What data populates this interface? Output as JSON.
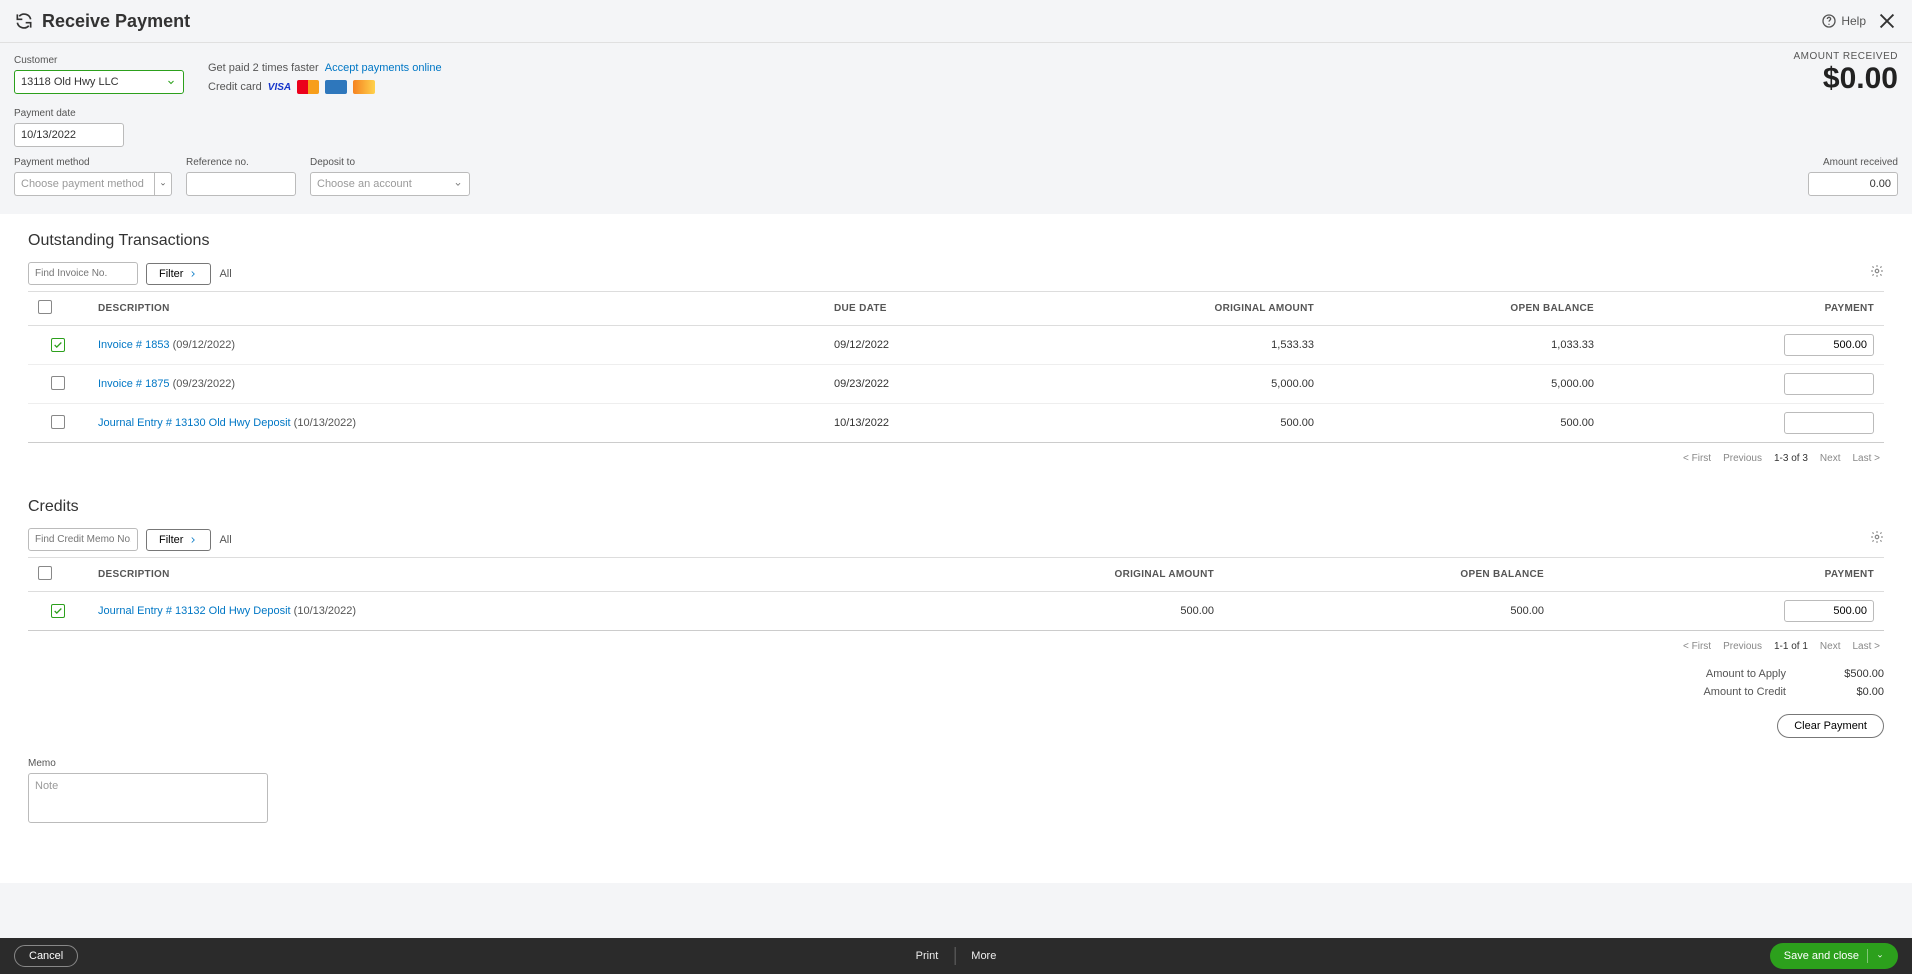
{
  "header": {
    "title": "Receive Payment",
    "help_label": "Help"
  },
  "customer": {
    "label": "Customer",
    "value": "13118 Old Hwy LLC"
  },
  "promo": {
    "prefix": "Get paid 2 times faster",
    "link": "Accept payments online",
    "cc_label": "Credit card"
  },
  "amount_display": {
    "label": "AMOUNT RECEIVED",
    "value": "$0.00"
  },
  "fields": {
    "payment_date": {
      "label": "Payment date",
      "value": "10/13/2022"
    },
    "payment_method": {
      "label": "Payment method",
      "placeholder": "Choose payment method"
    },
    "reference_no": {
      "label": "Reference no.",
      "value": ""
    },
    "deposit_to": {
      "label": "Deposit to",
      "placeholder": "Choose an account"
    },
    "amount_received": {
      "label": "Amount received",
      "value": "0.00"
    }
  },
  "outstanding": {
    "title": "Outstanding Transactions",
    "search_placeholder": "Find Invoice No.",
    "filter_label": "Filter",
    "all_label": "All",
    "columns": {
      "description": "DESCRIPTION",
      "due_date": "DUE DATE",
      "original_amount": "ORIGINAL AMOUNT",
      "open_balance": "OPEN BALANCE",
      "payment": "PAYMENT"
    },
    "rows": [
      {
        "checked": true,
        "link_text": "Invoice # 1853",
        "suffix": " (09/12/2022)",
        "due_date": "09/12/2022",
        "original": "1,533.33",
        "open": "1,033.33",
        "payment": "500.00"
      },
      {
        "checked": false,
        "link_text": "Invoice # 1875",
        "suffix": " (09/23/2022)",
        "due_date": "09/23/2022",
        "original": "5,000.00",
        "open": "5,000.00",
        "payment": ""
      },
      {
        "checked": false,
        "link_text": "Journal Entry # 13130 Old Hwy Deposit",
        "suffix": " (10/13/2022)",
        "due_date": "10/13/2022",
        "original": "500.00",
        "open": "500.00",
        "payment": ""
      }
    ],
    "pager": {
      "first": "< First",
      "prev": "Previous",
      "range": "1-3 of 3",
      "next": "Next",
      "last": "Last >"
    }
  },
  "credits": {
    "title": "Credits",
    "search_placeholder": "Find Credit Memo No.",
    "filter_label": "Filter",
    "all_label": "All",
    "columns": {
      "description": "DESCRIPTION",
      "original_amount": "ORIGINAL AMOUNT",
      "open_balance": "OPEN BALANCE",
      "payment": "PAYMENT"
    },
    "rows": [
      {
        "checked": true,
        "link_text": "Journal Entry # 13132 Old Hwy Deposit",
        "suffix": " (10/13/2022)",
        "original": "500.00",
        "open": "500.00",
        "payment": "500.00"
      }
    ],
    "pager": {
      "first": "< First",
      "prev": "Previous",
      "range": "1-1 of 1",
      "next": "Next",
      "last": "Last >"
    }
  },
  "totals": {
    "apply_label": "Amount to Apply",
    "apply_value": "$500.00",
    "credit_label": "Amount to Credit",
    "credit_value": "$0.00",
    "clear_label": "Clear Payment"
  },
  "memo": {
    "label": "Memo",
    "placeholder": "Note"
  },
  "footer": {
    "cancel": "Cancel",
    "print": "Print",
    "more": "More",
    "save": "Save and close"
  }
}
